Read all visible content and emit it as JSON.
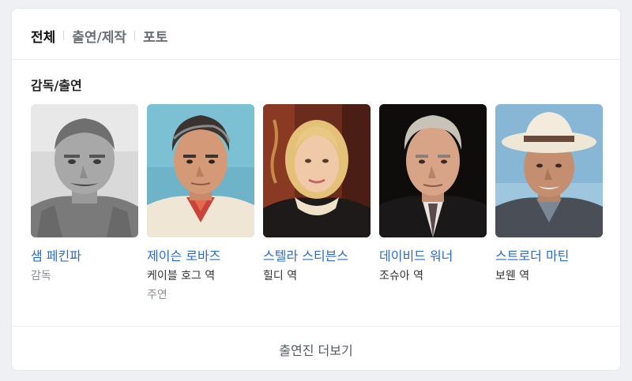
{
  "tabs": [
    {
      "label": "전체",
      "active": true
    },
    {
      "label": "출연/제작",
      "active": false
    },
    {
      "label": "포토",
      "active": false
    }
  ],
  "section_title": "감독/출연",
  "people": [
    {
      "name": "샘 페킨파",
      "role": "감독",
      "sub": ""
    },
    {
      "name": "제이슨 로바즈",
      "role": "케이블 호그 역",
      "sub": "주연"
    },
    {
      "name": "스텔라 스티븐스",
      "role": "힐디 역",
      "sub": ""
    },
    {
      "name": "데이비드 워너",
      "role": "조슈아 역",
      "sub": ""
    },
    {
      "name": "스트로더 마틴",
      "role": "보웬 역",
      "sub": ""
    }
  ],
  "more_label": "출연진 더보기",
  "colors": {
    "link": "#2a6bd1",
    "muted": "#8a8f96"
  }
}
